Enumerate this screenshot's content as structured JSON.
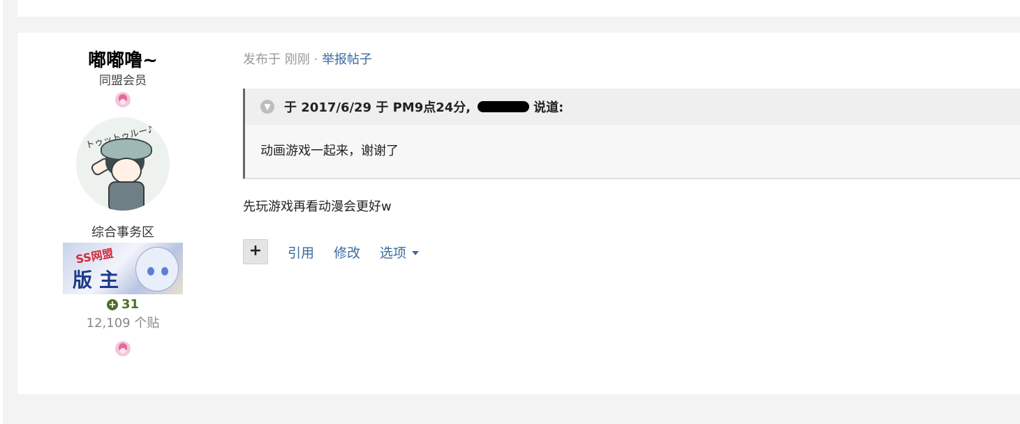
{
  "author": {
    "name": "嘟嘟噜~",
    "group": "同盟会员",
    "forum": "综合事务区",
    "badge_ss_text": "SS网盟",
    "badge_main_text": "版主",
    "avatar_caption": "トゥットゥルー♪",
    "reputation": "31",
    "post_count": "12,109 个贴"
  },
  "post": {
    "meta_prefix": "发布于 刚刚",
    "meta_separator": "·",
    "report_label": "举报帖子",
    "quote_header_prefix": "于 2017/6/29 于 PM9点24分,",
    "quote_header_suffix": "说道:",
    "quote_text": "动画游戏一起来，谢谢了",
    "body_text": "先玩游戏再看动漫会更好w"
  },
  "actions": {
    "plus_label": "+",
    "quote_label": "引用",
    "edit_label": "修改",
    "options_label": "选项"
  },
  "icons": {
    "reputation": "plus-circle-icon",
    "quote_collapse": "chevron-down-icon",
    "options": "caret-down-icon"
  },
  "colors": {
    "link": "#3a6a9e",
    "reputation": "#4f6e2e"
  }
}
